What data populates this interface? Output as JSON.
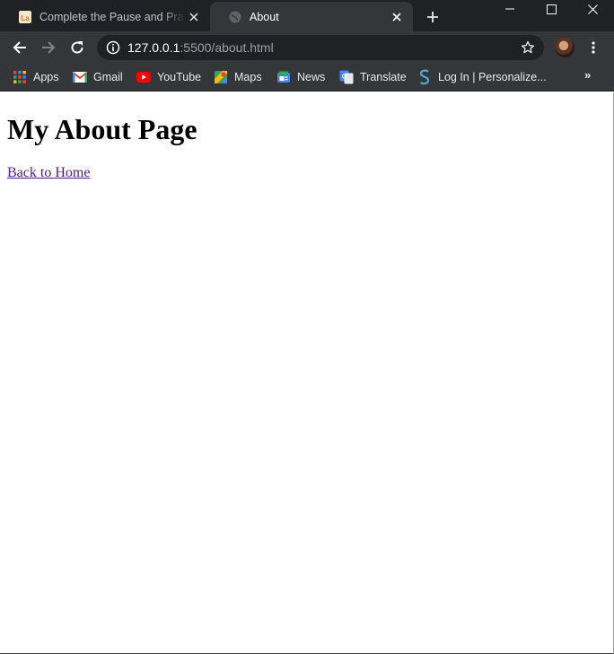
{
  "tabs": [
    {
      "title": "Complete the Pause and Practi",
      "favicon": "la-icon",
      "active": false
    },
    {
      "title": "About",
      "favicon": "globe-icon",
      "active": true
    }
  ],
  "address_bar": {
    "host": "127.0.0.1",
    "path": ":5500/about.html"
  },
  "bookmarks": [
    {
      "label": "Apps",
      "icon": "apps-grid-icon"
    },
    {
      "label": "Gmail",
      "icon": "gmail-icon"
    },
    {
      "label": "YouTube",
      "icon": "youtube-icon"
    },
    {
      "label": "Maps",
      "icon": "maps-icon"
    },
    {
      "label": "News",
      "icon": "news-icon"
    },
    {
      "label": "Translate",
      "icon": "translate-icon"
    },
    {
      "label": "Log In | Personalize...",
      "icon": "s-logo-icon"
    }
  ],
  "page": {
    "heading": "My About Page",
    "link_text": "Back to Home"
  },
  "colors": {
    "frame": "#202124",
    "toolbar": "#35363a",
    "visited_link": "#551a8b"
  }
}
